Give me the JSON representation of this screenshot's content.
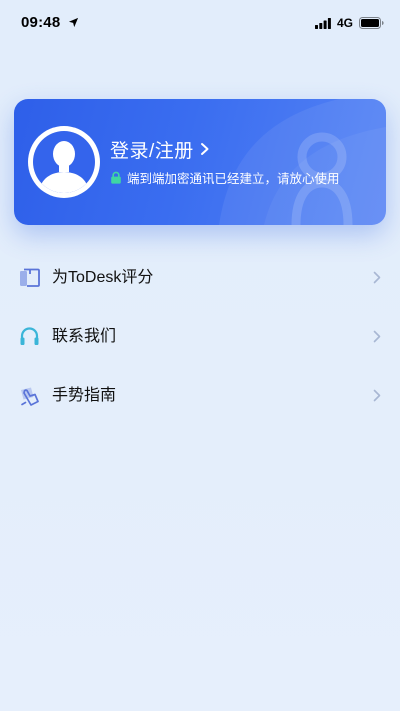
{
  "status_bar": {
    "time": "09:48",
    "network": "4G",
    "icons": [
      "location-arrow-icon",
      "signal-icon",
      "battery-icon"
    ]
  },
  "profile_card": {
    "login_label": "登录/注册",
    "secure_notice": "端到端加密通讯已经建立，请放心使用",
    "icons": [
      "avatar-placeholder-icon",
      "chevron-right-icon",
      "lock-icon"
    ],
    "accent_colors": {
      "card_start": "#2e5fe9",
      "card_end": "#5684f5",
      "lock": "#3fd6a3"
    }
  },
  "menu": {
    "items": [
      {
        "label": "为ToDesk评分",
        "icon": "rate-icon"
      },
      {
        "label": "联系我们",
        "icon": "headset-icon"
      },
      {
        "label": "手势指南",
        "icon": "gesture-icon"
      }
    ]
  }
}
